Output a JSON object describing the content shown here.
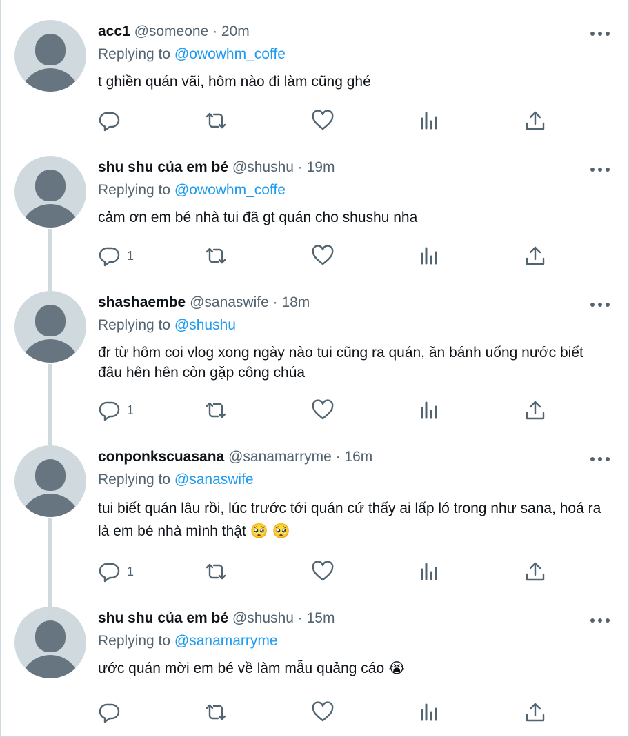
{
  "tweets": [
    {
      "name": "acc1",
      "meta": "@someone · 20m",
      "replying_prefix": "Replying to ",
      "replying_to": "@owowhm_coffe",
      "text": "t ghiền quán vãi, hôm nào đi làm cũng ghé",
      "reply_count": ""
    },
    {
      "name": "shu shu của em bé",
      "meta": "@shushu · 19m",
      "replying_prefix": "Replying to ",
      "replying_to": "@owowhm_coffe",
      "text": "cảm ơn em bé nhà tui đã gt quán cho shushu nha",
      "reply_count": "1"
    },
    {
      "name": "shashaembe",
      "meta": "@sanaswife · 18m",
      "replying_prefix": "Replying to ",
      "replying_to": "@shushu",
      "text": "đr từ hôm coi vlog xong ngày nào tui cũng ra quán, ăn bánh uống nước biết đâu hên hên còn gặp công chúa",
      "reply_count": "1"
    },
    {
      "name": "conponkscuasana",
      "meta": "@sanamarryme · 16m",
      "replying_prefix": "Replying to ",
      "replying_to": "@sanaswife",
      "text": "tui biết quán lâu rồi, lúc trước tới quán cứ thấy ai lấp ló trong như sana, hoá ra là em bé nhà mình thật 🥺 🥺",
      "reply_count": "1"
    },
    {
      "name": "shu shu của em bé",
      "meta": "@shushu · 15m",
      "replying_prefix": "Replying to ",
      "replying_to": "@sanamarryme",
      "text": "ước quán mời em bé về làm mẫu quảng cáo 😭",
      "reply_count": ""
    }
  ],
  "icons": {
    "reply": "reply-icon",
    "retweet": "retweet-icon",
    "like": "heart-icon",
    "views": "views-icon",
    "share": "share-icon",
    "more": "more-icon"
  },
  "colors": {
    "mention": "#1d9bf0",
    "secondary_text": "#536471",
    "avatar_bg": "#cfd9de",
    "avatar_fg": "#66757f"
  }
}
